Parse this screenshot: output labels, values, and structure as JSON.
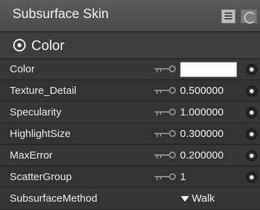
{
  "header": {
    "title": "Subsurface Skin"
  },
  "group": {
    "label": "Color"
  },
  "rows": [
    {
      "name": "Color",
      "value": "",
      "kind": "color",
      "color": "#FFFFFF"
    },
    {
      "name": "Texture_Detail",
      "value": "0.500000",
      "kind": "number"
    },
    {
      "name": "Specularity",
      "value": "1.000000",
      "kind": "number"
    },
    {
      "name": "HighlightSize",
      "value": "0.300000",
      "kind": "number"
    },
    {
      "name": "MaxError",
      "value": "0.200000",
      "kind": "number"
    },
    {
      "name": "ScatterGroup",
      "value": "1",
      "kind": "number"
    },
    {
      "name": "SubsurfaceMethod",
      "value": "Walk",
      "kind": "dropdown"
    }
  ],
  "icons": {
    "list": "list-icon",
    "curl": "page-curl-icon",
    "toggle": "expand-toggle-icon",
    "key": "key-connect-icon",
    "radio": "input-connector-icon",
    "dropdown": "triangle-down-icon"
  }
}
